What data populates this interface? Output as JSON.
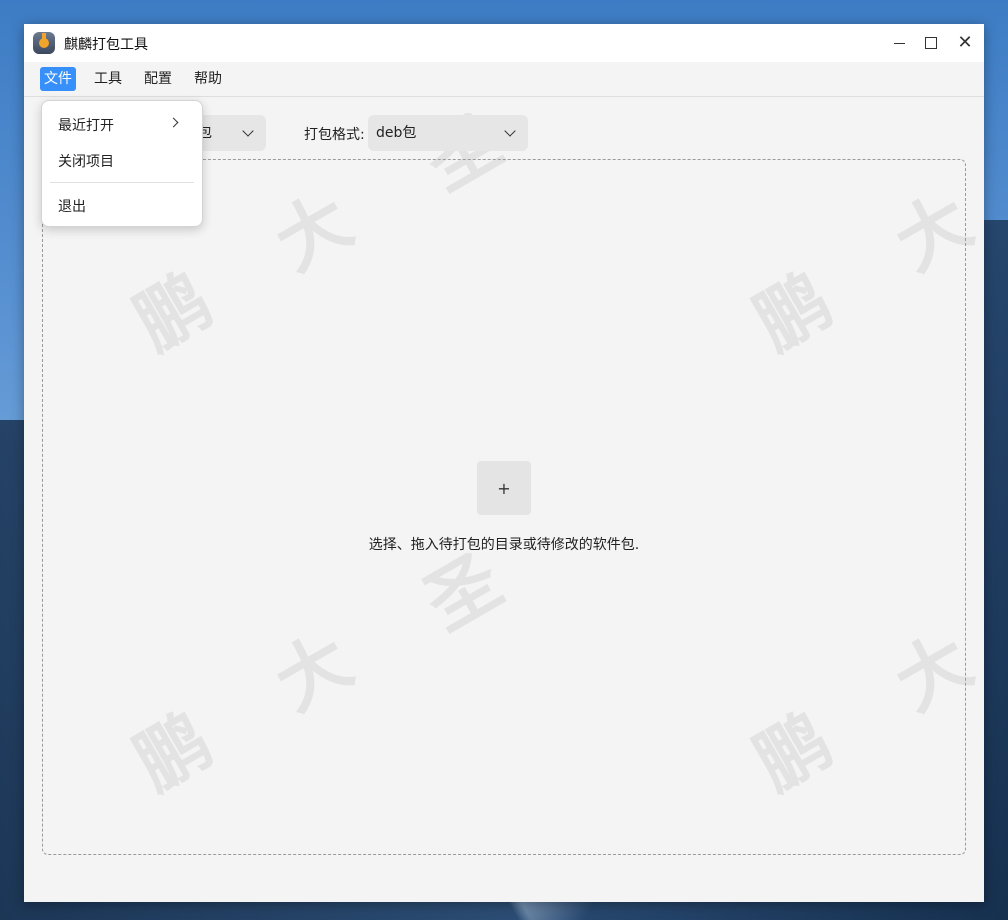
{
  "window": {
    "title": "麒麟打包工具"
  },
  "menubar": {
    "items": [
      "文件",
      "工具",
      "配置",
      "帮助"
    ]
  },
  "toolbar": {
    "left_combo_value": "包",
    "format_label": "打包格式:",
    "format_value": "deb包"
  },
  "dropzone": {
    "add_label": "+",
    "hint": "选择、拖入待打包的目录或待修改的软件包."
  },
  "file_menu": {
    "recent": "最近打开",
    "close_project": "关闭项目",
    "exit": "退出"
  },
  "watermark": {
    "chars": [
      "鹏",
      "大",
      "圣"
    ]
  },
  "colors": {
    "accent": "#3790fa"
  }
}
